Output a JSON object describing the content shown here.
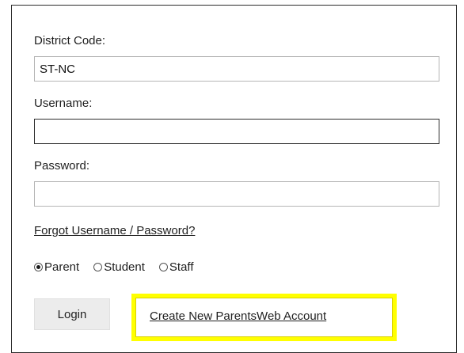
{
  "login_form": {
    "district_code": {
      "label": "District Code:",
      "value": "ST-NC"
    },
    "username": {
      "label": "Username:",
      "value": ""
    },
    "password": {
      "label": "Password:",
      "value": ""
    },
    "forgot_link": "Forgot Username / Password?",
    "roles": [
      {
        "label": "Parent",
        "selected": true
      },
      {
        "label": "Student",
        "selected": false
      },
      {
        "label": "Staff",
        "selected": false
      }
    ],
    "login_button": "Login",
    "create_account_link": "Create New ParentsWeb Account"
  },
  "colors": {
    "highlight": "#ffff00",
    "panel_border": "#2b2b2b",
    "button_background": "#ececec"
  }
}
